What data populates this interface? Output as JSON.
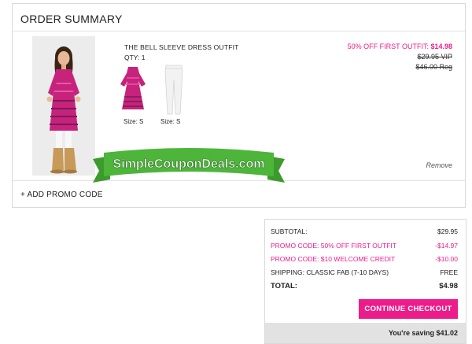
{
  "summary": {
    "title": "ORDER SUMMARY",
    "product": {
      "name": "THE BELL SLEEVE DRESS OUTFIT",
      "qty": "QTY: 1",
      "items": [
        {
          "icon": "pink-bell-sleeve-dress",
          "size": "Size: S"
        },
        {
          "icon": "white-leggings",
          "size": "Size: S"
        }
      ],
      "price_promo_label": "50% OFF FIRST OUTFIT:",
      "price_promo_value": "$14.98",
      "price_vip": "$29.95 VIP",
      "price_reg": "$46.00 Reg",
      "remove_label": "Remove"
    },
    "promo_code_label": "+ ADD PROMO CODE"
  },
  "banner": {
    "text": "SimpleCouponDeals.com"
  },
  "totals": {
    "rows": [
      {
        "label": "SUBTOTAL:",
        "value": "$29.95"
      },
      {
        "label": "PROMO CODE: 50% OFF FIRST OUTFIT",
        "value": "-$14.97"
      },
      {
        "label": "PROMO CODE: $10 WELCOME CREDIT",
        "value": "-$10.00"
      },
      {
        "label": "SHIPPING: CLASSIC FAB (7-10 DAYS)",
        "value": "FREE"
      },
      {
        "label": "TOTAL:",
        "value": "$4.98"
      }
    ],
    "checkout_label": "CONTINUE CHECKOUT",
    "saving_text": "You're saving $41.02"
  },
  "colors": {
    "accent": "#ec1d8b",
    "banner_green": "#4db53a"
  }
}
